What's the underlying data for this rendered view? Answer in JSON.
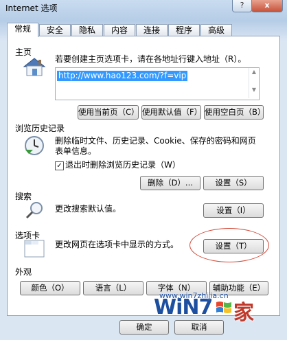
{
  "window": {
    "title": "Internet 选项",
    "help": "?",
    "close": "x"
  },
  "tabs": [
    "常规",
    "安全",
    "隐私",
    "内容",
    "连接",
    "程序",
    "高级"
  ],
  "home": {
    "section": "主页",
    "desc": "若要创建主页选项卡，请在各地址行键入地址（R）。",
    "url": "http://www.hao123.com/?f=vip",
    "buttons": [
      "使用当前页（C）",
      "使用默认值（F）",
      "使用空白页（B）"
    ]
  },
  "history": {
    "section": "浏览历史记录",
    "desc": "删除临时文件、历史记录、Cookie、保存的密码和网页表单信息。",
    "checkbox": "退出时删除浏览历史记录（W）",
    "delete": "删除（D）...",
    "settings": "设置（S）"
  },
  "search": {
    "section": "搜索",
    "desc": "更改搜索默认值。",
    "settings": "设置（I）"
  },
  "tabs_sec": {
    "section": "选项卡",
    "desc": "更改网页在选项卡中显示的方式。",
    "settings": "设置（T）"
  },
  "appearance": {
    "section": "外观",
    "buttons": [
      "颜色（O）",
      "语言（L）",
      "字体（N）",
      "辅助功能（E）"
    ]
  },
  "footer": {
    "ok": "确定",
    "cancel": "取消"
  },
  "watermark": {
    "brand": "WiN7",
    "jia": "家",
    "url": "www.win7zhijia.cn"
  },
  "colors": {
    "accent": "#3399ff",
    "highlight_oval": "#d24a3a",
    "watermark_blue": "#1d4fa0"
  }
}
